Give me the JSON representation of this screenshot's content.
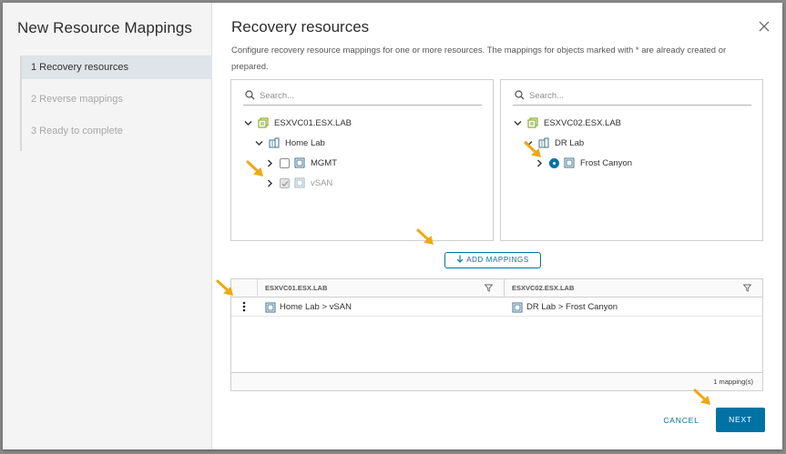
{
  "sidebar": {
    "title": "New Resource Mappings",
    "steps": [
      {
        "label": "1  Recovery resources"
      },
      {
        "label": "2  Reverse mappings"
      },
      {
        "label": "3  Ready to complete"
      }
    ]
  },
  "header": {
    "title": "Recovery resources",
    "description": "Configure recovery resource mappings for one or more resources. The mappings for objects marked with * are already created or prepared."
  },
  "left_panel": {
    "search_placeholder": "Search...",
    "tree": {
      "root": "ESXVC01.ESX.LAB",
      "folder": "Home Lab",
      "items": [
        {
          "label": "MGMT",
          "checked": false
        },
        {
          "label": "vSAN",
          "checked": true
        }
      ]
    }
  },
  "right_panel": {
    "search_placeholder": "Search...",
    "tree": {
      "root": "ESXVC02.ESX.LAB",
      "folder": "DR Lab",
      "items": [
        {
          "label": "Frost Canyon",
          "selected": true
        }
      ]
    }
  },
  "add_mappings_label": "ADD MAPPINGS",
  "grid": {
    "columns": [
      "ESXVC01.ESX.LAB",
      "ESXVC02.ESX.LAB"
    ],
    "rows": [
      {
        "source": "Home Lab > vSAN",
        "target": "DR Lab > Frost Canyon"
      }
    ],
    "footer": "1 mapping(s)"
  },
  "buttons": {
    "cancel": "CANCEL",
    "next": "NEXT"
  },
  "colors": {
    "accent": "#0072a3",
    "annotation_arrow": "#f0a810",
    "vcenter_icon": "#7fa61c"
  },
  "icons": {
    "close": "close-icon",
    "search": "search-icon",
    "vcenter": "vcenter-icon",
    "datacenter": "datacenter-icon",
    "cluster": "cluster-icon",
    "filter": "filter-icon",
    "kebab": "kebab-menu-icon",
    "add": "arrow-down-icon"
  }
}
